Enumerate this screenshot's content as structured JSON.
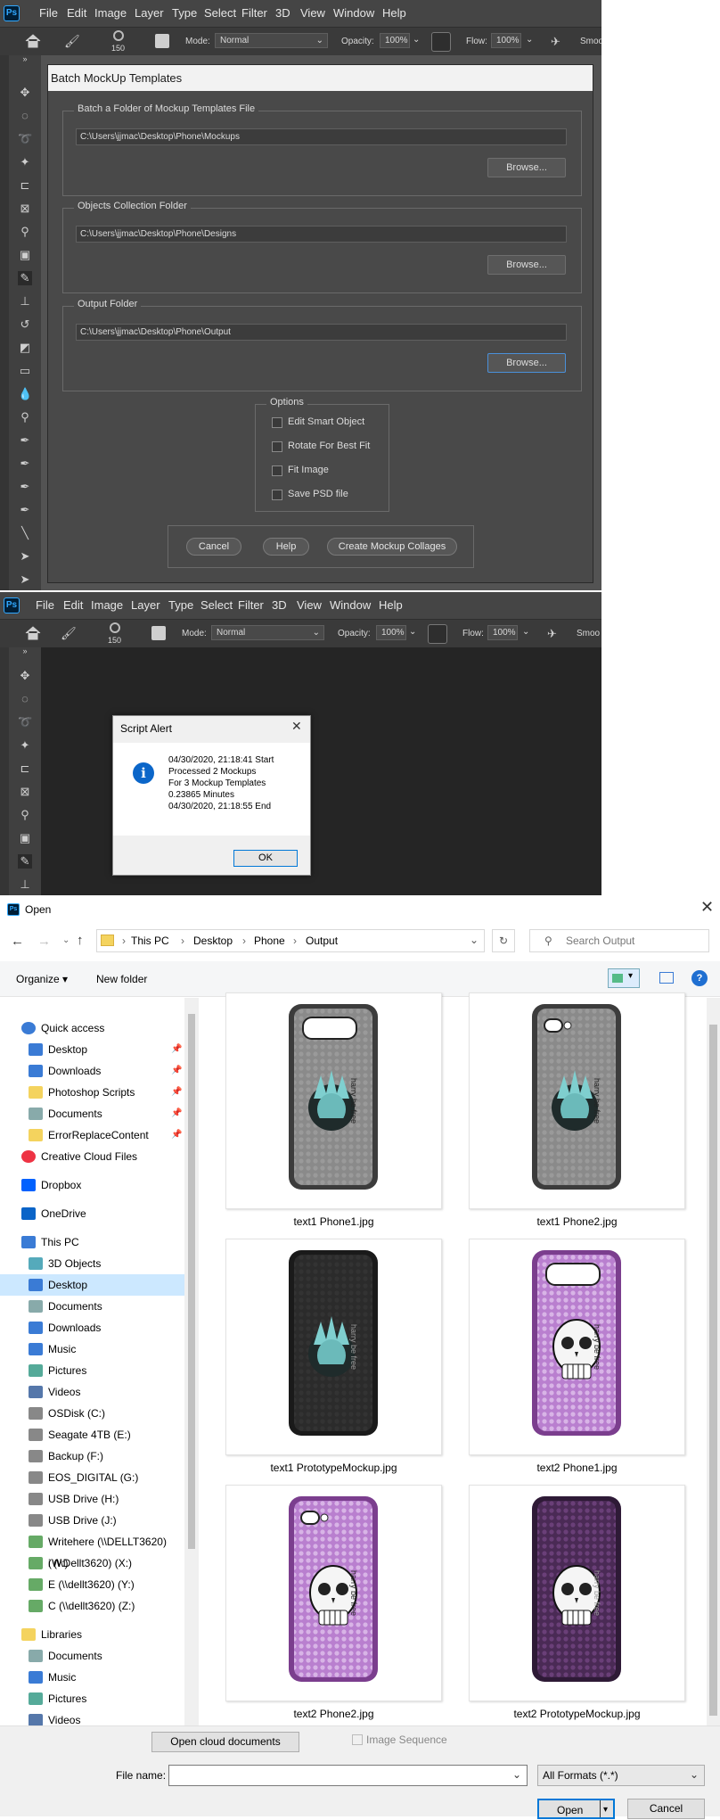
{
  "photoshop_top": {
    "menu": [
      "File",
      "Edit",
      "Image",
      "Layer",
      "Type",
      "Select",
      "Filter",
      "3D",
      "View",
      "Window",
      "Help"
    ],
    "options": {
      "brush_size": "150",
      "mode_label": "Mode:",
      "mode_value": "Normal",
      "opacity_label": "Opacity:",
      "opacity_value": "100%",
      "flow_label": "Flow:",
      "flow_value": "100%",
      "smooth_label": "Smoo"
    },
    "dialog": {
      "title": "Batch MockUp Templates",
      "group1": {
        "legend": "Batch a Folder of Mockup Templates File",
        "path": "C:\\Users\\jjmac\\Desktop\\Phone\\Mockups",
        "browse": "Browse..."
      },
      "group2": {
        "legend": "Objects Collection Folder",
        "path": "C:\\Users\\jjmac\\Desktop\\Phone\\Designs",
        "browse": "Browse..."
      },
      "group3": {
        "legend": "Output Folder",
        "path": "C:\\Users\\jjmac\\Desktop\\Phone\\Output",
        "browse": "Browse..."
      },
      "options": {
        "legend": "Options",
        "items": [
          "Edit Smart Object",
          "Rotate For Best Fit",
          "Fit Image",
          "Save PSD file"
        ]
      },
      "buttons": {
        "cancel": "Cancel",
        "help": "Help",
        "create": "Create Mockup Collages"
      }
    }
  },
  "photoshop_bottom": {
    "menu": [
      "File",
      "Edit",
      "Image",
      "Layer",
      "Type",
      "Select",
      "Filter",
      "3D",
      "View",
      "Window",
      "Help"
    ],
    "options": {
      "brush_size": "150",
      "mode_label": "Mode:",
      "mode_value": "Normal",
      "opacity_label": "Opacity:",
      "opacity_value": "100%",
      "flow_label": "Flow:",
      "flow_value": "100%",
      "smooth_label": "Smoo"
    },
    "alert": {
      "title": "Script Alert",
      "lines": [
        "04/30/2020, 21:18:41 Start",
        "Processed 2 Mockups",
        "For 3 Mockup Templates",
        "0.23865 Minutes",
        "04/30/2020, 21:18:55  End"
      ],
      "ok": "OK"
    }
  },
  "open_dialog": {
    "title": "Open",
    "breadcrumb": [
      "This PC",
      "Desktop",
      "Phone",
      "Output"
    ],
    "search_placeholder": "Search Output",
    "organize": "Organize",
    "new_folder": "New folder",
    "nav": [
      {
        "label": "Quick access",
        "icon": "star-icon",
        "pinned": false
      },
      {
        "label": "Desktop",
        "icon": "desktop-icon",
        "pinned": true
      },
      {
        "label": "Downloads",
        "icon": "download-icon",
        "pinned": true
      },
      {
        "label": "Photoshop Scripts",
        "icon": "folder-icon",
        "pinned": true
      },
      {
        "label": "Documents",
        "icon": "documents-icon",
        "pinned": true
      },
      {
        "label": "ErrorReplaceContent",
        "icon": "folder-icon",
        "pinned": true
      },
      {
        "label": "Creative Cloud Files",
        "icon": "creative-cloud-icon",
        "pinned": false
      },
      {
        "label": "Dropbox",
        "icon": "dropbox-icon",
        "pinned": false
      },
      {
        "label": "OneDrive",
        "icon": "cloud-icon",
        "pinned": false
      },
      {
        "label": "This PC",
        "icon": "computer-icon",
        "pinned": false
      },
      {
        "label": "3D Objects",
        "icon": "cube-icon",
        "pinned": false
      },
      {
        "label": "Desktop",
        "icon": "desktop-icon",
        "pinned": false
      },
      {
        "label": "Documents",
        "icon": "documents-icon",
        "pinned": false
      },
      {
        "label": "Downloads",
        "icon": "download-icon",
        "pinned": false
      },
      {
        "label": "Music",
        "icon": "music-icon",
        "pinned": false
      },
      {
        "label": "Pictures",
        "icon": "pictures-icon",
        "pinned": false
      },
      {
        "label": "Videos",
        "icon": "videos-icon",
        "pinned": false
      },
      {
        "label": "OSDisk (C:)",
        "icon": "drive-icon",
        "pinned": false
      },
      {
        "label": "Seagate 4TB (E:)",
        "icon": "drive-icon",
        "pinned": false
      },
      {
        "label": "Backup (F:)",
        "icon": "drive-icon",
        "pinned": false
      },
      {
        "label": "EOS_DIGITAL (G:)",
        "icon": "drive-icon",
        "pinned": false
      },
      {
        "label": "USB Drive (H:)",
        "icon": "drive-icon",
        "pinned": false
      },
      {
        "label": "USB Drive (J:)",
        "icon": "drive-icon",
        "pinned": false
      },
      {
        "label": "Writehere (\\\\DELLT3620) (W:)",
        "icon": "network-drive-icon",
        "pinned": false
      },
      {
        "label": "i (\\\\Dellt3620) (X:)",
        "icon": "network-drive-icon",
        "pinned": false
      },
      {
        "label": "E (\\\\dellt3620) (Y:)",
        "icon": "network-drive-icon",
        "pinned": false
      },
      {
        "label": "C (\\\\dellt3620) (Z:)",
        "icon": "network-drive-icon",
        "pinned": false
      },
      {
        "label": "Libraries",
        "icon": "libraries-icon",
        "pinned": false
      },
      {
        "label": "Documents",
        "icon": "documents-icon",
        "pinned": false
      },
      {
        "label": "Music",
        "icon": "music-icon",
        "pinned": false
      },
      {
        "label": "Pictures",
        "icon": "pictures-icon",
        "pinned": false
      },
      {
        "label": "Videos",
        "icon": "videos-icon",
        "pinned": false
      }
    ],
    "selected_nav_index": 11,
    "files": [
      {
        "name": "text1 Phone1.jpg",
        "case": "gray",
        "design": "liberty"
      },
      {
        "name": "text1 Phone2.jpg",
        "case": "gray2",
        "design": "liberty"
      },
      {
        "name": "text1 PrototypeMockup.jpg",
        "case": "dark",
        "design": "liberty"
      },
      {
        "name": "text2 Phone1.jpg",
        "case": "purple",
        "design": "skull"
      },
      {
        "name": "text2 Phone2.jpg",
        "case": "purple2",
        "design": "skull"
      },
      {
        "name": "text2 PrototypeMockup.jpg",
        "case": "darkpurple",
        "design": "skull"
      }
    ],
    "open_cloud": "Open cloud documents",
    "image_sequence": "Image Sequence",
    "file_name_label": "File name:",
    "file_name_value": "",
    "format": "All Formats (*.*)",
    "open": "Open",
    "cancel": "Cancel",
    "case_text": "harry be free"
  },
  "colors": {
    "ps_bg": "#535353",
    "accent": "#0078d7",
    "purple": "#9b4fb5"
  }
}
